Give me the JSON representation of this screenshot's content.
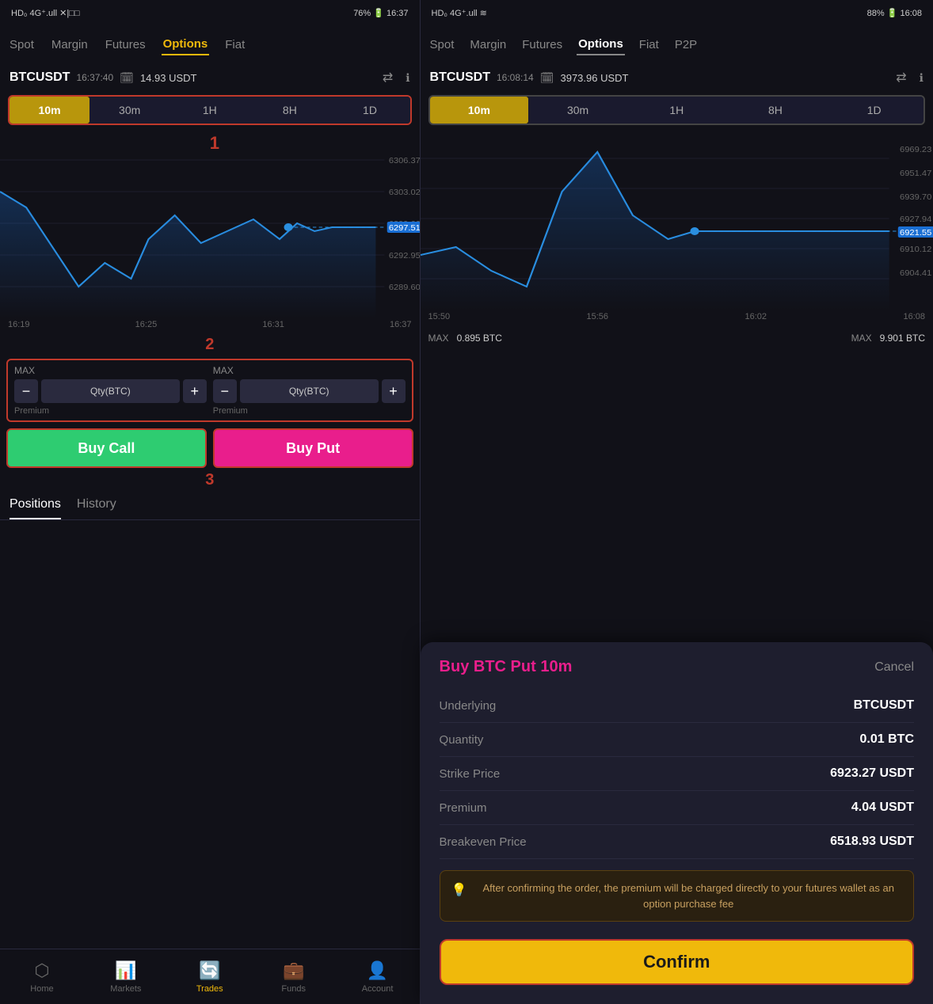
{
  "left": {
    "status": {
      "carrier": "HD₀ 4G⁺.ull ✕|□□",
      "battery": "76% 🔋 16:37"
    },
    "nav": {
      "items": [
        "Spot",
        "Margin",
        "Futures",
        "Options",
        "Fiat"
      ],
      "active": "Options"
    },
    "ticker": {
      "symbol": "BTCUSDT",
      "time": "16:37:40",
      "price": "14.93 USDT"
    },
    "intervals": [
      "10m",
      "30m",
      "1H",
      "8H",
      "1D"
    ],
    "active_interval": "10m",
    "chart": {
      "label": "1",
      "y_labels": [
        "6306.37",
        "6303.02",
        "6299.66",
        "6297.51",
        "6292.95",
        "6289.60"
      ],
      "highlighted_price": "6297.51",
      "x_labels": [
        "16:19",
        "16:25",
        "16:31",
        "16:37"
      ]
    },
    "label_2": "2",
    "order": {
      "left": {
        "max": "MAX",
        "qty_label": "Qty(BTC)",
        "premium": "Premium"
      },
      "right": {
        "max": "MAX",
        "qty_label": "Qty(BTC)",
        "premium": "Premium"
      }
    },
    "buy_call": "Buy Call",
    "buy_put": "Buy Put",
    "label_3": "3",
    "tabs": {
      "positions": "Positions",
      "history": "History",
      "active": "Positions"
    },
    "bottom_nav": [
      {
        "label": "Home",
        "icon": "⬡"
      },
      {
        "label": "Markets",
        "icon": "📊"
      },
      {
        "label": "Trades",
        "icon": "🔄",
        "active": true
      },
      {
        "label": "Funds",
        "icon": "💼"
      },
      {
        "label": "Account",
        "icon": "👤"
      }
    ]
  },
  "right": {
    "status": {
      "carrier": "HD₀ 4G⁺.ull ≋",
      "battery": "88% 🔋 16:08"
    },
    "nav": {
      "items": [
        "Spot",
        "Margin",
        "Futures",
        "Options",
        "Fiat",
        "P2P"
      ],
      "active": "Options"
    },
    "ticker": {
      "symbol": "BTCUSDT",
      "time": "16:08:14",
      "price": "3973.96 USDT"
    },
    "intervals": [
      "10m",
      "30m",
      "1H",
      "8H",
      "1D"
    ],
    "active_interval": "10m",
    "chart": {
      "y_labels": [
        "6969.23",
        "6951.47",
        "6939.70",
        "6927.94",
        "6921.55",
        "6910.12",
        "6904.41"
      ],
      "highlighted_price": "6921.55",
      "x_labels": [
        "15:50",
        "15:56",
        "16:02",
        "16:08"
      ]
    },
    "order_bar": {
      "left_max": "MAX",
      "left_qty": "0.895 BTC",
      "right_max": "MAX",
      "right_qty": "9.901 BTC"
    },
    "modal": {
      "title": "Buy BTC Put 10m",
      "cancel": "Cancel",
      "rows": [
        {
          "label": "Underlying",
          "value": "BTCUSDT"
        },
        {
          "label": "Quantity",
          "value": "0.01 BTC"
        },
        {
          "label": "Strike Price",
          "value": "6923.27 USDT"
        },
        {
          "label": "Premium",
          "value": "4.04 USDT"
        },
        {
          "label": "Breakeven Price",
          "value": "6518.93 USDT"
        }
      ],
      "notice": "After confirming the order, the premium will be charged directly to your futures wallet as an option purchase fee",
      "confirm_label": "Confirm"
    }
  }
}
